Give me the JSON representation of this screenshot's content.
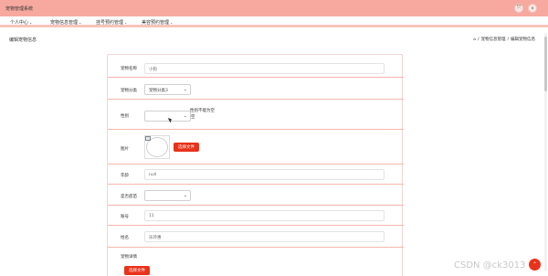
{
  "app": {
    "title": "宠物管理系统"
  },
  "topbar": {
    "fullscreen_icon": "⤧",
    "user_icon": "⚬"
  },
  "menu": [
    {
      "label": "个人中心"
    },
    {
      "label": "宠物信息管理"
    },
    {
      "label": "挂号预约管理"
    },
    {
      "label": "美容预约管理"
    }
  ],
  "page": {
    "title": "编辑宠物信息"
  },
  "breadcrumb": {
    "home_icon": "⌂",
    "items": [
      "宠物信息管理",
      "编辑宠物信息"
    ],
    "separator": "/"
  },
  "form": {
    "pet_name": {
      "label": "宠物名称",
      "value": "小狗"
    },
    "pet_category": {
      "label": "宠物分类",
      "value": "宠物分类3"
    },
    "gender": {
      "label": "性别",
      "value": "",
      "tip": "性别不能为空",
      "tip2": "空"
    },
    "image": {
      "label": "图片",
      "button": "选择文件"
    },
    "age": {
      "label": "年龄",
      "value": "null"
    },
    "vaccinated": {
      "label": "是否疫苗",
      "value": ""
    },
    "account": {
      "label": "账号",
      "value": "11"
    },
    "name": {
      "label": "姓名",
      "value": "乐玲惠"
    },
    "pet_detail": {
      "label": "宠物详情",
      "button": "选择文件"
    }
  },
  "watermark": "CSDN @ck3013",
  "colors": {
    "topbar": "#f7a99f",
    "accent": "#e8321a",
    "divider": "#f5b8ac"
  }
}
